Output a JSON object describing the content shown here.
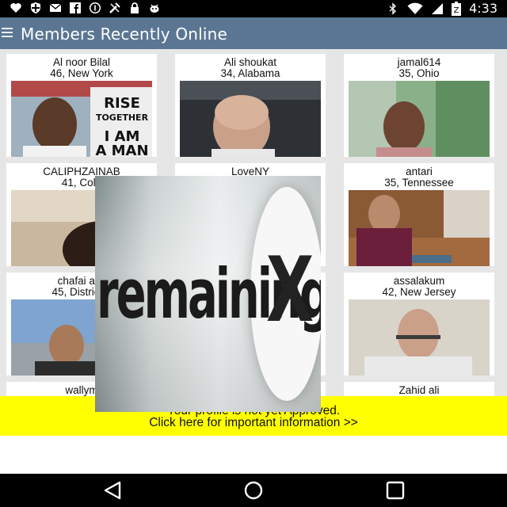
{
  "status_bar": {
    "time": "4:33",
    "left_icons": [
      "heart-icon",
      "shield-icon",
      "mail-icon",
      "facebook-icon",
      "circle-info-icon",
      "tools-icon",
      "lock-icon",
      "bug-icon"
    ],
    "right_icons": [
      "bluetooth-icon",
      "wifi-icon",
      "cell-signal-icon",
      "battery-icon"
    ]
  },
  "app_bar": {
    "title": "Members Recently Online",
    "menu_icon": "hamburger-menu-icon",
    "background": "#5a7693"
  },
  "members": [
    {
      "name": "Al noor Bilal",
      "location": "46, New York"
    },
    {
      "name": "Ali shoukat",
      "location": "34, Alabama"
    },
    {
      "name": "jamal614",
      "location": "35, Ohio"
    },
    {
      "name": "CALIPHZAINAB",
      "location": "41, Colo"
    },
    {
      "name": "LoveNY",
      "location": ""
    },
    {
      "name": "antari",
      "location": "35, Tennessee"
    },
    {
      "name": "chafai aits",
      "location": "45, District o"
    },
    {
      "name": "",
      "location": ""
    },
    {
      "name": "assalakum",
      "location": "42, New Jersey"
    },
    {
      "name": "wallym",
      "location": ""
    },
    {
      "name": "",
      "location": ""
    },
    {
      "name": "Zahid ali",
      "location": ""
    }
  ],
  "ad_overlay": {
    "text": "remaining",
    "close_glyph": "X"
  },
  "banner": {
    "line1": "Your profile is not yet Approved.",
    "line2": "Click here for important information >>",
    "background": "#ffff00"
  },
  "nav_bar": {
    "icons": [
      "back-triangle-icon",
      "home-circle-icon",
      "recents-square-icon"
    ]
  }
}
